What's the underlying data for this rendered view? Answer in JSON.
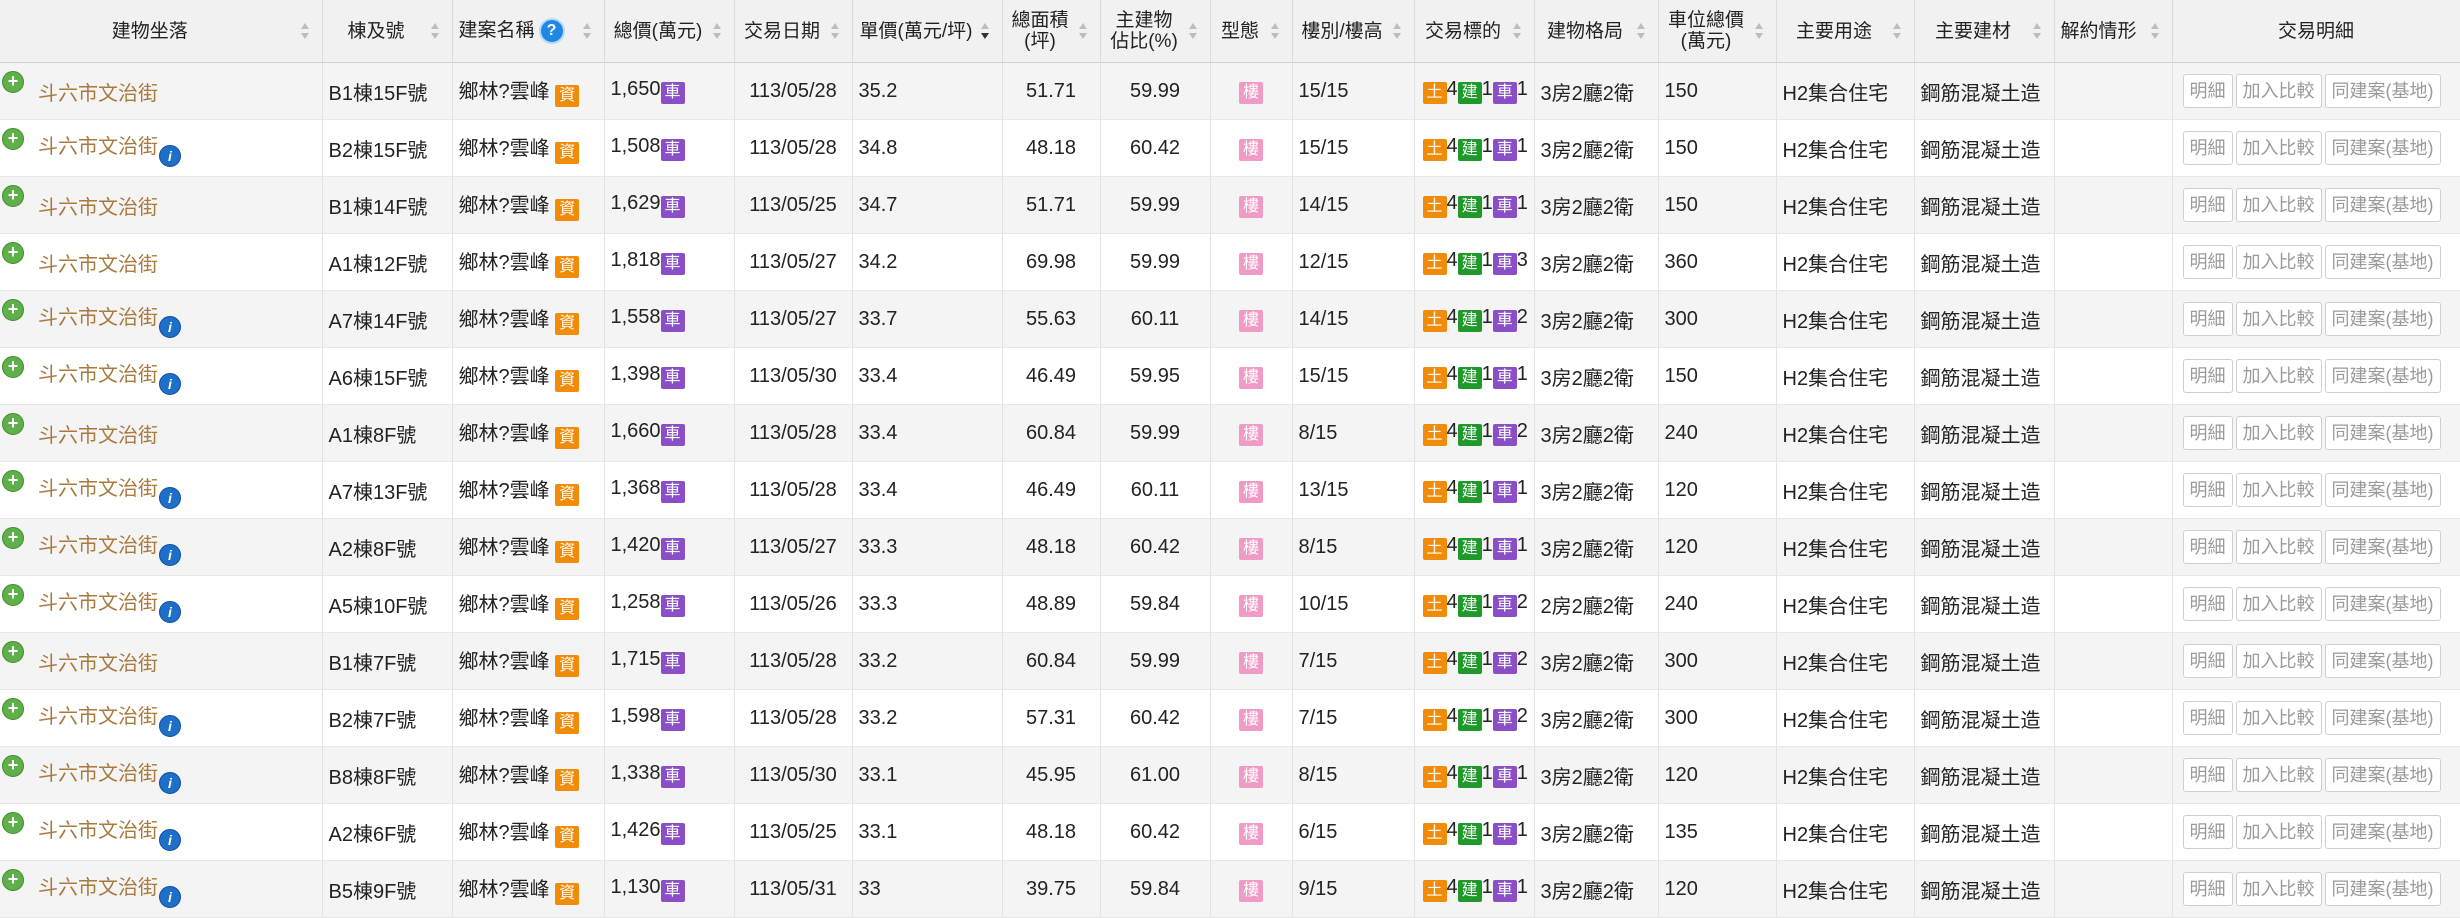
{
  "headers": [
    "建物坐落",
    "棟及號",
    "建案名稱",
    "總價(萬元)",
    "交易日期",
    "單價(萬元/坪)",
    "總面積\n(坪)",
    "主建物\n佔比(%)",
    "型態",
    "樓別/樓高",
    "交易標的",
    "建物格局",
    "車位總價\n(萬元)",
    "主要用途",
    "主要建材",
    "解約情形",
    "交易明細"
  ],
  "labels": {
    "car_badge": "車",
    "info_badge": "資",
    "type_badge": "樓",
    "land_badge": "土",
    "building_badge": "建",
    "plus": "+",
    "info_icon": "i",
    "help_icon": "?",
    "btn_detail": "明細",
    "btn_compare": "加入比較",
    "btn_same_case": "同建案(基地)"
  },
  "colors": {
    "address": "#a97a3d",
    "car_badge": "#8a4fc7",
    "land_badge": "#f08c0a",
    "building_badge": "#1f9a2a",
    "type_badge": "#ef9bc5",
    "info_icon": "#1e6fc9",
    "plus_icon": "#5fb04a"
  },
  "rows": [
    {
      "addr": "斗六市文治街",
      "info": false,
      "unit": "B1棟15F號",
      "case": "鄉林?雲峰",
      "total": "1,650",
      "date": "113/05/28",
      "unit_price": "35.2",
      "area": "51.71",
      "ratio": "59.99",
      "floor": "15/15",
      "land": "4",
      "bld": "1",
      "car": "1",
      "layout": "3房2廳2衛",
      "park": "150",
      "use": "H2集合住宅",
      "material": "鋼筋混凝土造",
      "cancel": ""
    },
    {
      "addr": "斗六市文治街",
      "info": true,
      "unit": "B2棟15F號",
      "case": "鄉林?雲峰",
      "total": "1,508",
      "date": "113/05/28",
      "unit_price": "34.8",
      "area": "48.18",
      "ratio": "60.42",
      "floor": "15/15",
      "land": "4",
      "bld": "1",
      "car": "1",
      "layout": "3房2廳2衛",
      "park": "150",
      "use": "H2集合住宅",
      "material": "鋼筋混凝土造",
      "cancel": ""
    },
    {
      "addr": "斗六市文治街",
      "info": false,
      "unit": "B1棟14F號",
      "case": "鄉林?雲峰",
      "total": "1,629",
      "date": "113/05/25",
      "unit_price": "34.7",
      "area": "51.71",
      "ratio": "59.99",
      "floor": "14/15",
      "land": "4",
      "bld": "1",
      "car": "1",
      "layout": "3房2廳2衛",
      "park": "150",
      "use": "H2集合住宅",
      "material": "鋼筋混凝土造",
      "cancel": ""
    },
    {
      "addr": "斗六市文治街",
      "info": false,
      "unit": "A1棟12F號",
      "case": "鄉林?雲峰",
      "total": "1,818",
      "date": "113/05/27",
      "unit_price": "34.2",
      "area": "69.98",
      "ratio": "59.99",
      "floor": "12/15",
      "land": "4",
      "bld": "1",
      "car": "3",
      "layout": "3房2廳2衛",
      "park": "360",
      "use": "H2集合住宅",
      "material": "鋼筋混凝土造",
      "cancel": ""
    },
    {
      "addr": "斗六市文治街",
      "info": true,
      "unit": "A7棟14F號",
      "case": "鄉林?雲峰",
      "total": "1,558",
      "date": "113/05/27",
      "unit_price": "33.7",
      "area": "55.63",
      "ratio": "60.11",
      "floor": "14/15",
      "land": "4",
      "bld": "1",
      "car": "2",
      "layout": "3房2廳2衛",
      "park": "300",
      "use": "H2集合住宅",
      "material": "鋼筋混凝土造",
      "cancel": ""
    },
    {
      "addr": "斗六市文治街",
      "info": true,
      "unit": "A6棟15F號",
      "case": "鄉林?雲峰",
      "total": "1,398",
      "date": "113/05/30",
      "unit_price": "33.4",
      "area": "46.49",
      "ratio": "59.95",
      "floor": "15/15",
      "land": "4",
      "bld": "1",
      "car": "1",
      "layout": "3房2廳2衛",
      "park": "150",
      "use": "H2集合住宅",
      "material": "鋼筋混凝土造",
      "cancel": ""
    },
    {
      "addr": "斗六市文治街",
      "info": false,
      "unit": "A1棟8F號",
      "case": "鄉林?雲峰",
      "total": "1,660",
      "date": "113/05/28",
      "unit_price": "33.4",
      "area": "60.84",
      "ratio": "59.99",
      "floor": "8/15",
      "land": "4",
      "bld": "1",
      "car": "2",
      "layout": "3房2廳2衛",
      "park": "240",
      "use": "H2集合住宅",
      "material": "鋼筋混凝土造",
      "cancel": ""
    },
    {
      "addr": "斗六市文治街",
      "info": true,
      "unit": "A7棟13F號",
      "case": "鄉林?雲峰",
      "total": "1,368",
      "date": "113/05/28",
      "unit_price": "33.4",
      "area": "46.49",
      "ratio": "60.11",
      "floor": "13/15",
      "land": "4",
      "bld": "1",
      "car": "1",
      "layout": "3房2廳2衛",
      "park": "120",
      "use": "H2集合住宅",
      "material": "鋼筋混凝土造",
      "cancel": ""
    },
    {
      "addr": "斗六市文治街",
      "info": true,
      "unit": "A2棟8F號",
      "case": "鄉林?雲峰",
      "total": "1,420",
      "date": "113/05/27",
      "unit_price": "33.3",
      "area": "48.18",
      "ratio": "60.42",
      "floor": "8/15",
      "land": "4",
      "bld": "1",
      "car": "1",
      "layout": "3房2廳2衛",
      "park": "120",
      "use": "H2集合住宅",
      "material": "鋼筋混凝土造",
      "cancel": ""
    },
    {
      "addr": "斗六市文治街",
      "info": true,
      "unit": "A5棟10F號",
      "case": "鄉林?雲峰",
      "total": "1,258",
      "date": "113/05/26",
      "unit_price": "33.3",
      "area": "48.89",
      "ratio": "59.84",
      "floor": "10/15",
      "land": "4",
      "bld": "1",
      "car": "2",
      "layout": "2房2廳2衛",
      "park": "240",
      "use": "H2集合住宅",
      "material": "鋼筋混凝土造",
      "cancel": ""
    },
    {
      "addr": "斗六市文治街",
      "info": false,
      "unit": "B1棟7F號",
      "case": "鄉林?雲峰",
      "total": "1,715",
      "date": "113/05/28",
      "unit_price": "33.2",
      "area": "60.84",
      "ratio": "59.99",
      "floor": "7/15",
      "land": "4",
      "bld": "1",
      "car": "2",
      "layout": "3房2廳2衛",
      "park": "300",
      "use": "H2集合住宅",
      "material": "鋼筋混凝土造",
      "cancel": ""
    },
    {
      "addr": "斗六市文治街",
      "info": true,
      "unit": "B2棟7F號",
      "case": "鄉林?雲峰",
      "total": "1,598",
      "date": "113/05/28",
      "unit_price": "33.2",
      "area": "57.31",
      "ratio": "60.42",
      "floor": "7/15",
      "land": "4",
      "bld": "1",
      "car": "2",
      "layout": "3房2廳2衛",
      "park": "300",
      "use": "H2集合住宅",
      "material": "鋼筋混凝土造",
      "cancel": ""
    },
    {
      "addr": "斗六市文治街",
      "info": true,
      "unit": "B8棟8F號",
      "case": "鄉林?雲峰",
      "total": "1,338",
      "date": "113/05/30",
      "unit_price": "33.1",
      "area": "45.95",
      "ratio": "61.00",
      "floor": "8/15",
      "land": "4",
      "bld": "1",
      "car": "1",
      "layout": "3房2廳2衛",
      "park": "120",
      "use": "H2集合住宅",
      "material": "鋼筋混凝土造",
      "cancel": ""
    },
    {
      "addr": "斗六市文治街",
      "info": true,
      "unit": "A2棟6F號",
      "case": "鄉林?雲峰",
      "total": "1,426",
      "date": "113/05/25",
      "unit_price": "33.1",
      "area": "48.18",
      "ratio": "60.42",
      "floor": "6/15",
      "land": "4",
      "bld": "1",
      "car": "1",
      "layout": "3房2廳2衛",
      "park": "135",
      "use": "H2集合住宅",
      "material": "鋼筋混凝土造",
      "cancel": ""
    },
    {
      "addr": "斗六市文治街",
      "info": true,
      "unit": "B5棟9F號",
      "case": "鄉林?雲峰",
      "total": "1,130",
      "date": "113/05/31",
      "unit_price": "33",
      "area": "39.75",
      "ratio": "59.84",
      "floor": "9/15",
      "land": "4",
      "bld": "1",
      "car": "1",
      "layout": "3房2廳2衛",
      "park": "120",
      "use": "H2集合住宅",
      "material": "鋼筋混凝土造",
      "cancel": ""
    }
  ]
}
